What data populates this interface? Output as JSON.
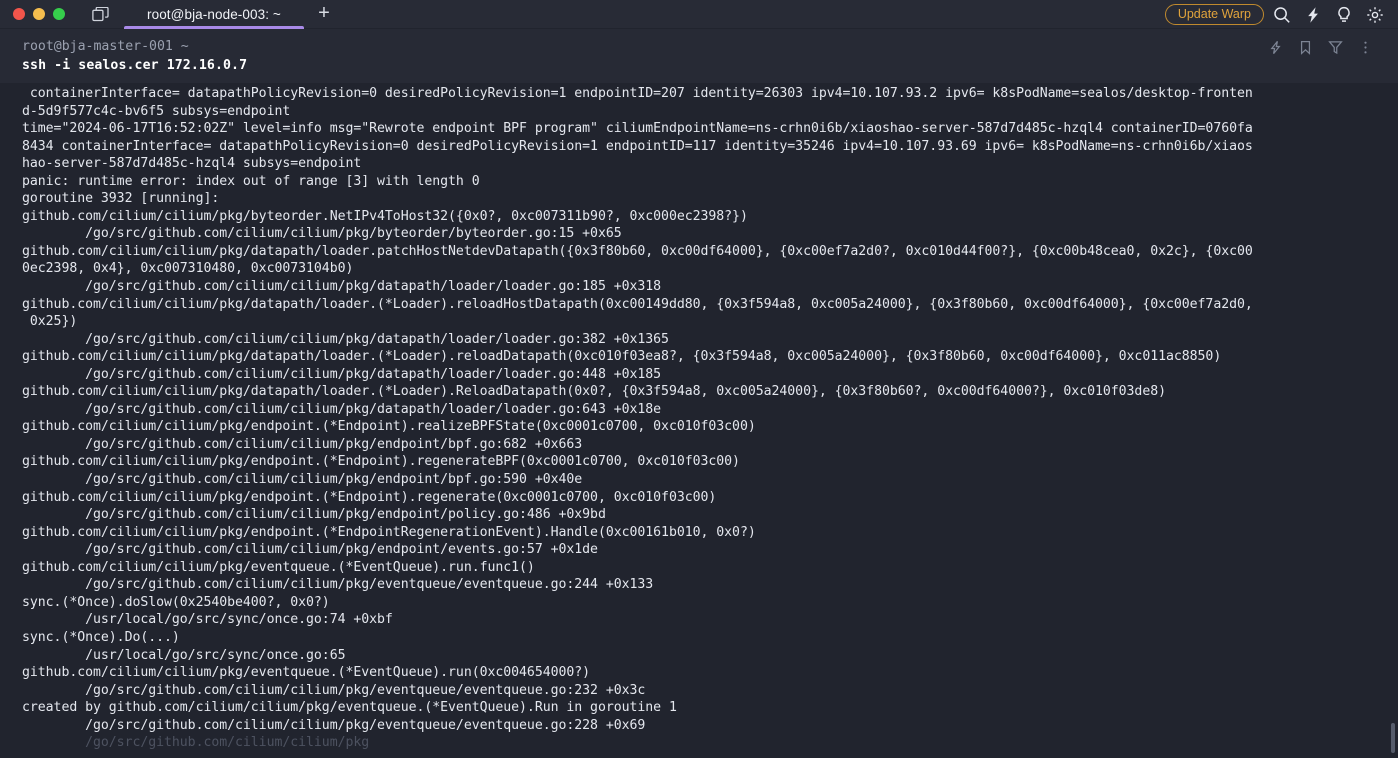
{
  "window": {
    "traffic_lights": [
      "close",
      "minimize",
      "maximize"
    ],
    "split_pane_icon": "split-pane-icon",
    "new_tab_label": "+",
    "tab_accent_color": "#a98ae8",
    "background_color": "#21242e",
    "block_background_color": "#272a35"
  },
  "tabs": [
    {
      "label": "root@bja-node-003: ~",
      "active": true
    }
  ],
  "titlebar_right": {
    "update_label": "Update Warp",
    "update_color": "#e0a33c",
    "icons": [
      "search-icon",
      "lightning-icon",
      "lightbulb-icon",
      "gear-icon"
    ]
  },
  "block": {
    "prompt_path": "root@bja-master-001 ~",
    "command": "ssh -i sealos.cer 172.16.0.7",
    "actions": [
      "lightning-icon",
      "bookmark-icon",
      "filter-icon",
      "more-options-icon"
    ]
  },
  "terminal": {
    "lines": [
      " containerInterface= datapathPolicyRevision=0 desiredPolicyRevision=1 endpointID=207 identity=26303 ipv4=10.107.93.2 ipv6= k8sPodName=sealos/desktop-fronten",
      "d-5d9f577c4c-bv6f5 subsys=endpoint",
      "time=\"2024-06-17T16:52:02Z\" level=info msg=\"Rewrote endpoint BPF program\" ciliumEndpointName=ns-crhn0i6b/xiaoshao-server-587d7d485c-hzql4 containerID=0760fa",
      "8434 containerInterface= datapathPolicyRevision=0 desiredPolicyRevision=1 endpointID=117 identity=35246 ipv4=10.107.93.69 ipv6= k8sPodName=ns-crhn0i6b/xiaos",
      "hao-server-587d7d485c-hzql4 subsys=endpoint",
      "panic: runtime error: index out of range [3] with length 0",
      "",
      "goroutine 3932 [running]:",
      "github.com/cilium/cilium/pkg/byteorder.NetIPv4ToHost32({0x0?, 0xc007311b90?, 0xc000ec2398?})",
      "        /go/src/github.com/cilium/cilium/pkg/byteorder/byteorder.go:15 +0x65",
      "github.com/cilium/cilium/pkg/datapath/loader.patchHostNetdevDatapath({0x3f80b60, 0xc00df64000}, {0xc00ef7a2d0?, 0xc010d44f00?}, {0xc00b48cea0, 0x2c}, {0xc00",
      "0ec2398, 0x4}, 0xc007310480, 0xc0073104b0)",
      "        /go/src/github.com/cilium/cilium/pkg/datapath/loader/loader.go:185 +0x318",
      "github.com/cilium/cilium/pkg/datapath/loader.(*Loader).reloadHostDatapath(0xc00149dd80, {0x3f594a8, 0xc005a24000}, {0x3f80b60, 0xc00df64000}, {0xc00ef7a2d0,",
      " 0x25})",
      "        /go/src/github.com/cilium/cilium/pkg/datapath/loader/loader.go:382 +0x1365",
      "github.com/cilium/cilium/pkg/datapath/loader.(*Loader).reloadDatapath(0xc010f03ea8?, {0x3f594a8, 0xc005a24000}, {0x3f80b60, 0xc00df64000}, 0xc011ac8850)",
      "        /go/src/github.com/cilium/cilium/pkg/datapath/loader/loader.go:448 +0x185",
      "github.com/cilium/cilium/pkg/datapath/loader.(*Loader).ReloadDatapath(0x0?, {0x3f594a8, 0xc005a24000}, {0x3f80b60?, 0xc00df64000?}, 0xc010f03de8)",
      "        /go/src/github.com/cilium/cilium/pkg/datapath/loader/loader.go:643 +0x18e",
      "github.com/cilium/cilium/pkg/endpoint.(*Endpoint).realizeBPFState(0xc0001c0700, 0xc010f03c00)",
      "        /go/src/github.com/cilium/cilium/pkg/endpoint/bpf.go:682 +0x663",
      "github.com/cilium/cilium/pkg/endpoint.(*Endpoint).regenerateBPF(0xc0001c0700, 0xc010f03c00)",
      "        /go/src/github.com/cilium/cilium/pkg/endpoint/bpf.go:590 +0x40e",
      "github.com/cilium/cilium/pkg/endpoint.(*Endpoint).regenerate(0xc0001c0700, 0xc010f03c00)",
      "        /go/src/github.com/cilium/cilium/pkg/endpoint/policy.go:486 +0x9bd",
      "github.com/cilium/cilium/pkg/endpoint.(*EndpointRegenerationEvent).Handle(0xc00161b010, 0x0?)",
      "        /go/src/github.com/cilium/cilium/pkg/endpoint/events.go:57 +0x1de",
      "github.com/cilium/cilium/pkg/eventqueue.(*EventQueue).run.func1()",
      "        /go/src/github.com/cilium/cilium/pkg/eventqueue/eventqueue.go:244 +0x133",
      "sync.(*Once).doSlow(0x2540be400?, 0x0?)",
      "        /usr/local/go/src/sync/once.go:74 +0xbf",
      "sync.(*Once).Do(...)",
      "        /usr/local/go/src/sync/once.go:65",
      "github.com/cilium/cilium/pkg/eventqueue.(*EventQueue).run(0xc004654000?)",
      "        /go/src/github.com/cilium/cilium/pkg/eventqueue/eventqueue.go:232 +0x3c",
      "created by github.com/cilium/cilium/pkg/eventqueue.(*EventQueue).Run in goroutine 1",
      "        /go/src/github.com/cilium/cilium/pkg/eventqueue/eventqueue.go:228 +0x69"
    ],
    "partial_last_line": "        /go/src/github.com/cilium/cilium/pkg"
  }
}
